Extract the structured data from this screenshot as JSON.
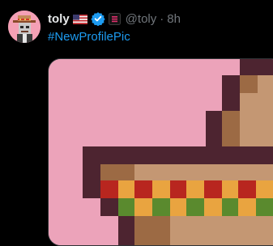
{
  "tweet": {
    "display_name": "toly",
    "handle": "@toly",
    "separator": "·",
    "time": "8h",
    "hashtag": "#NewProfilePic",
    "icons": {
      "avatar": "pixel-art-avatar-sombrero",
      "flag": "us-flag-icon",
      "verified": "verified-badge-icon",
      "affiliation": "solana-affiliate-icon"
    }
  },
  "colors": {
    "background": "#000000",
    "text_primary": "#e7e9ea",
    "text_secondary": "#71767b",
    "link": "#1d9bf0",
    "verified": "#1d9bf0",
    "image_background": "#eca3ba"
  }
}
